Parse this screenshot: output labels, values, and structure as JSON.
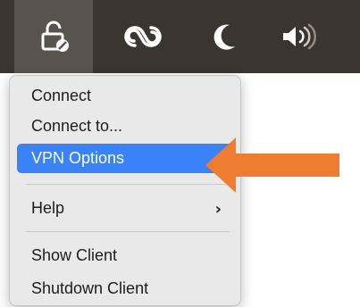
{
  "menubar": {
    "icons": [
      "vpn-lock-icon",
      "creative-cloud-icon",
      "moon-icon",
      "speaker-icon"
    ]
  },
  "menu": {
    "items": [
      {
        "label": "Connect"
      },
      {
        "label": "Connect to..."
      },
      {
        "label": "VPN Options"
      },
      {
        "label": "Help"
      },
      {
        "label": "Show Client"
      },
      {
        "label": "Shutdown Client"
      }
    ],
    "highlighted": "VPN Options"
  },
  "colors": {
    "menubar": "#3a352f",
    "highlight": "#3a82f7",
    "annotation_arrow": "#ef7d31"
  }
}
